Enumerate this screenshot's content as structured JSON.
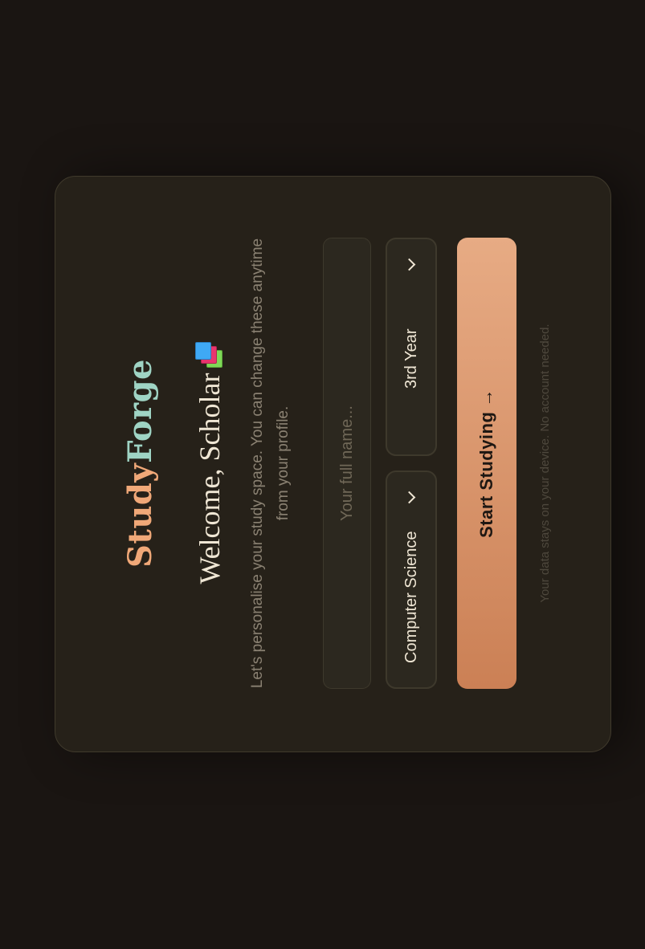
{
  "brand": {
    "part1": "Study",
    "part2": "Forge",
    "colors": {
      "study": "#f0a878",
      "forge": "#9fd4c4"
    }
  },
  "welcome": {
    "title": "Welcome, Scholar",
    "icon": "books-icon"
  },
  "subtitle": "Let's personalise your study space. You can change these anytime from your profile.",
  "form": {
    "name_placeholder": "Your full name...",
    "name_value": "",
    "major_selected": "Computer Science",
    "year_selected": "3rd Year"
  },
  "cta": {
    "label": "Start Studying",
    "arrow": "→",
    "color": "#e7ab84"
  },
  "footer": "Your data stays on your device. No account needed."
}
